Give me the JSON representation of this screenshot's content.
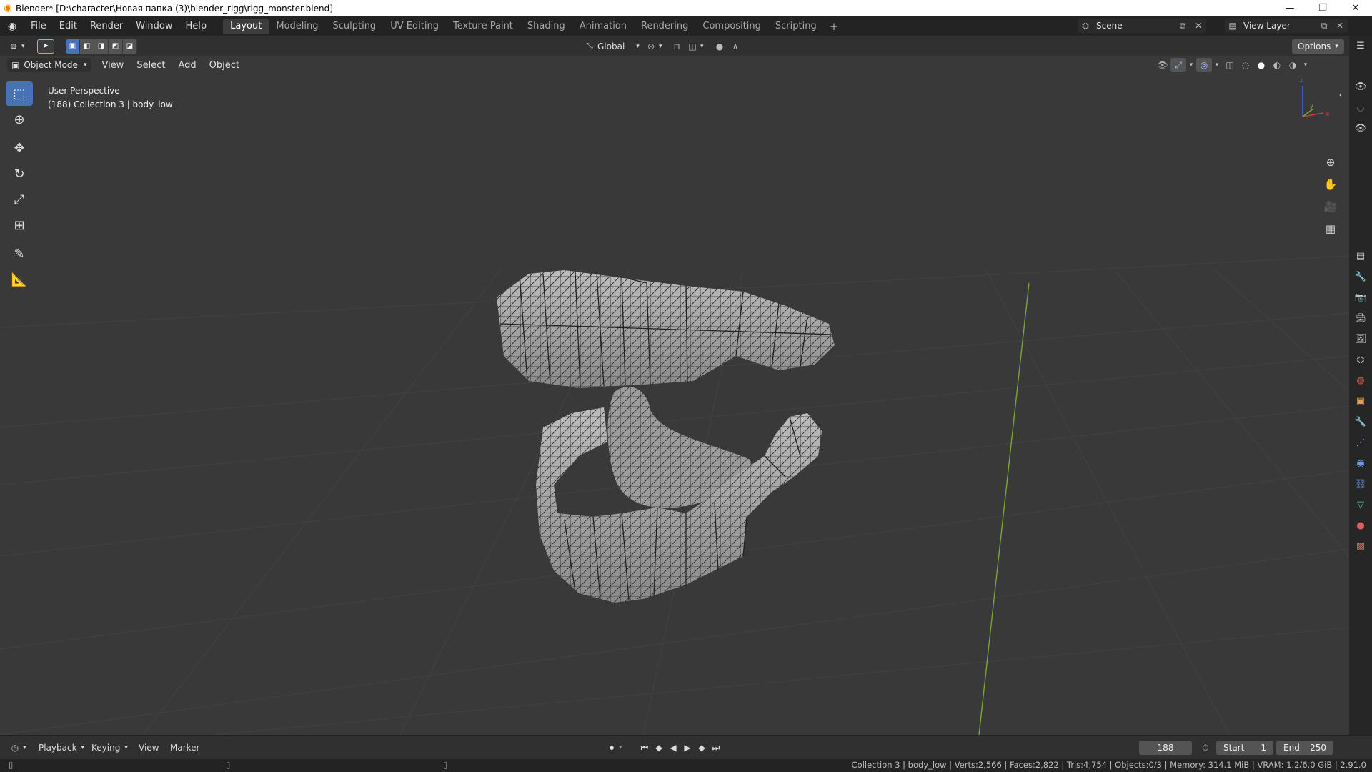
{
  "window": {
    "title": "Blender* [D:\\character\\Новая папка (3)\\blender_rigg\\rigg_monster.blend]",
    "minimize_icon": "minimize-icon",
    "maximize_icon": "restore-icon",
    "close_icon": "close-icon"
  },
  "topbar": {
    "menus": [
      "File",
      "Edit",
      "Render",
      "Window",
      "Help"
    ],
    "workspaces": [
      "Layout",
      "Modeling",
      "Sculpting",
      "UV Editing",
      "Texture Paint",
      "Shading",
      "Animation",
      "Rendering",
      "Compositing",
      "Scripting"
    ],
    "active_workspace": "Layout",
    "scene": "Scene",
    "view_layer": "View Layer"
  },
  "header": {
    "transform_orientation": "Global",
    "options_label": "Options"
  },
  "viewport_header": {
    "mode": "Object Mode",
    "menus": [
      "View",
      "Select",
      "Add",
      "Object"
    ]
  },
  "viewport": {
    "perspective_label": "User Perspective",
    "collection_label": "(188) Collection 3 | body_low"
  },
  "toolbar": {
    "tools": [
      "select-box-icon",
      "cursor-icon",
      "move-icon",
      "rotate-icon",
      "scale-icon",
      "transform-icon",
      "annotate-icon",
      "measure-icon"
    ]
  },
  "timeline": {
    "menus": [
      "Playback",
      "Keying",
      "View",
      "Marker"
    ],
    "current_frame": "188",
    "start_label": "Start",
    "start_value": "1",
    "end_label": "End",
    "end_value": "250"
  },
  "statusbar": {
    "stats": "Collection 3 | body_low | Verts:2,566 | Faces:2,822 | Tris:4,754 | Objects:0/3 | Memory: 314.1 MiB | VRAM: 1.2/6.0 GiB | 2.91.0"
  },
  "colors": {
    "accent": "#4772b3",
    "blender_orange": "#e87d0d",
    "grid_y_axis": "#7ea33b"
  }
}
